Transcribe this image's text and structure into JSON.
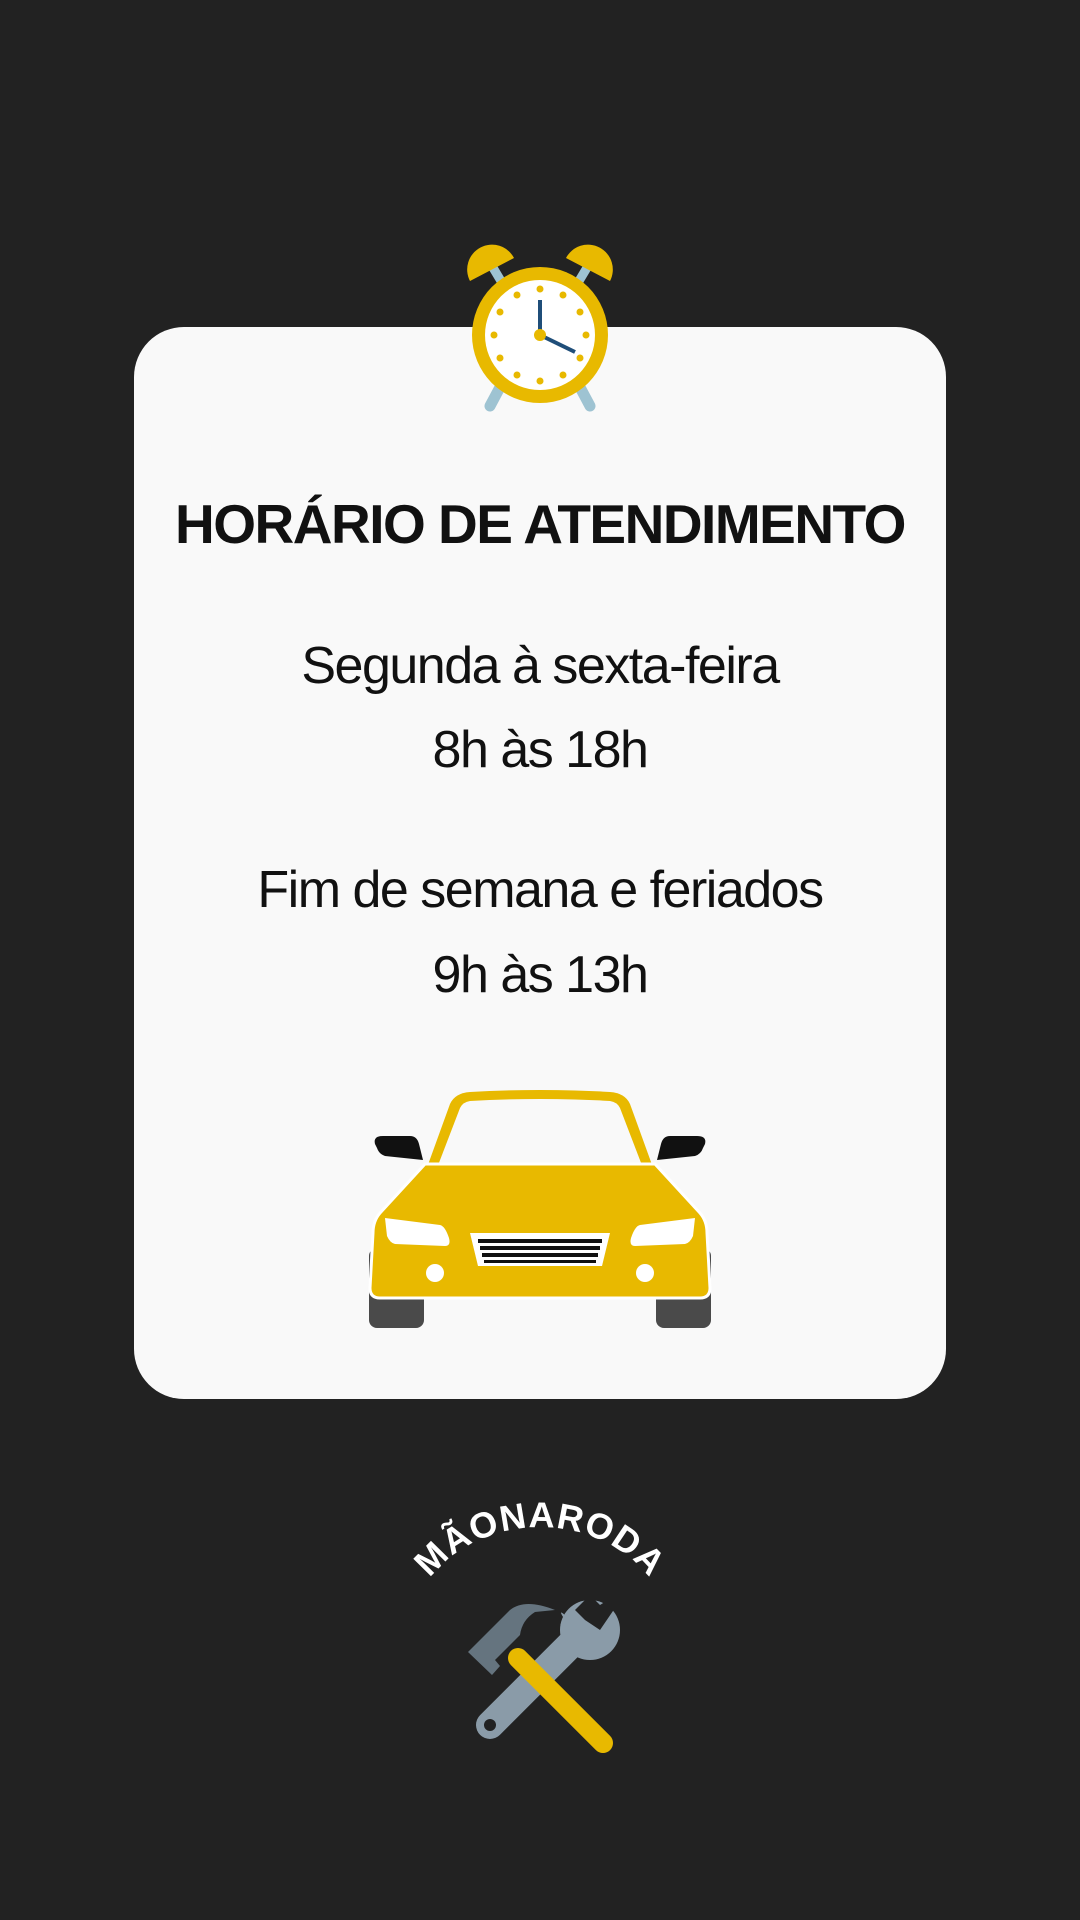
{
  "title": "HORÁRIO DE ATENDIMENTO",
  "schedule": [
    {
      "days": "Segunda à sexta-feira",
      "hours": "8h às 18h"
    },
    {
      "days": "Fim de semana e feriados",
      "hours": "9h às 13h"
    }
  ],
  "brand": "MÃONARODA",
  "colors": {
    "background": "#222222",
    "card": "#f9f9f9",
    "accent": "#e8b900"
  },
  "icons": [
    "alarm-clock-icon",
    "car-icon",
    "hammer-wrench-icon"
  ]
}
